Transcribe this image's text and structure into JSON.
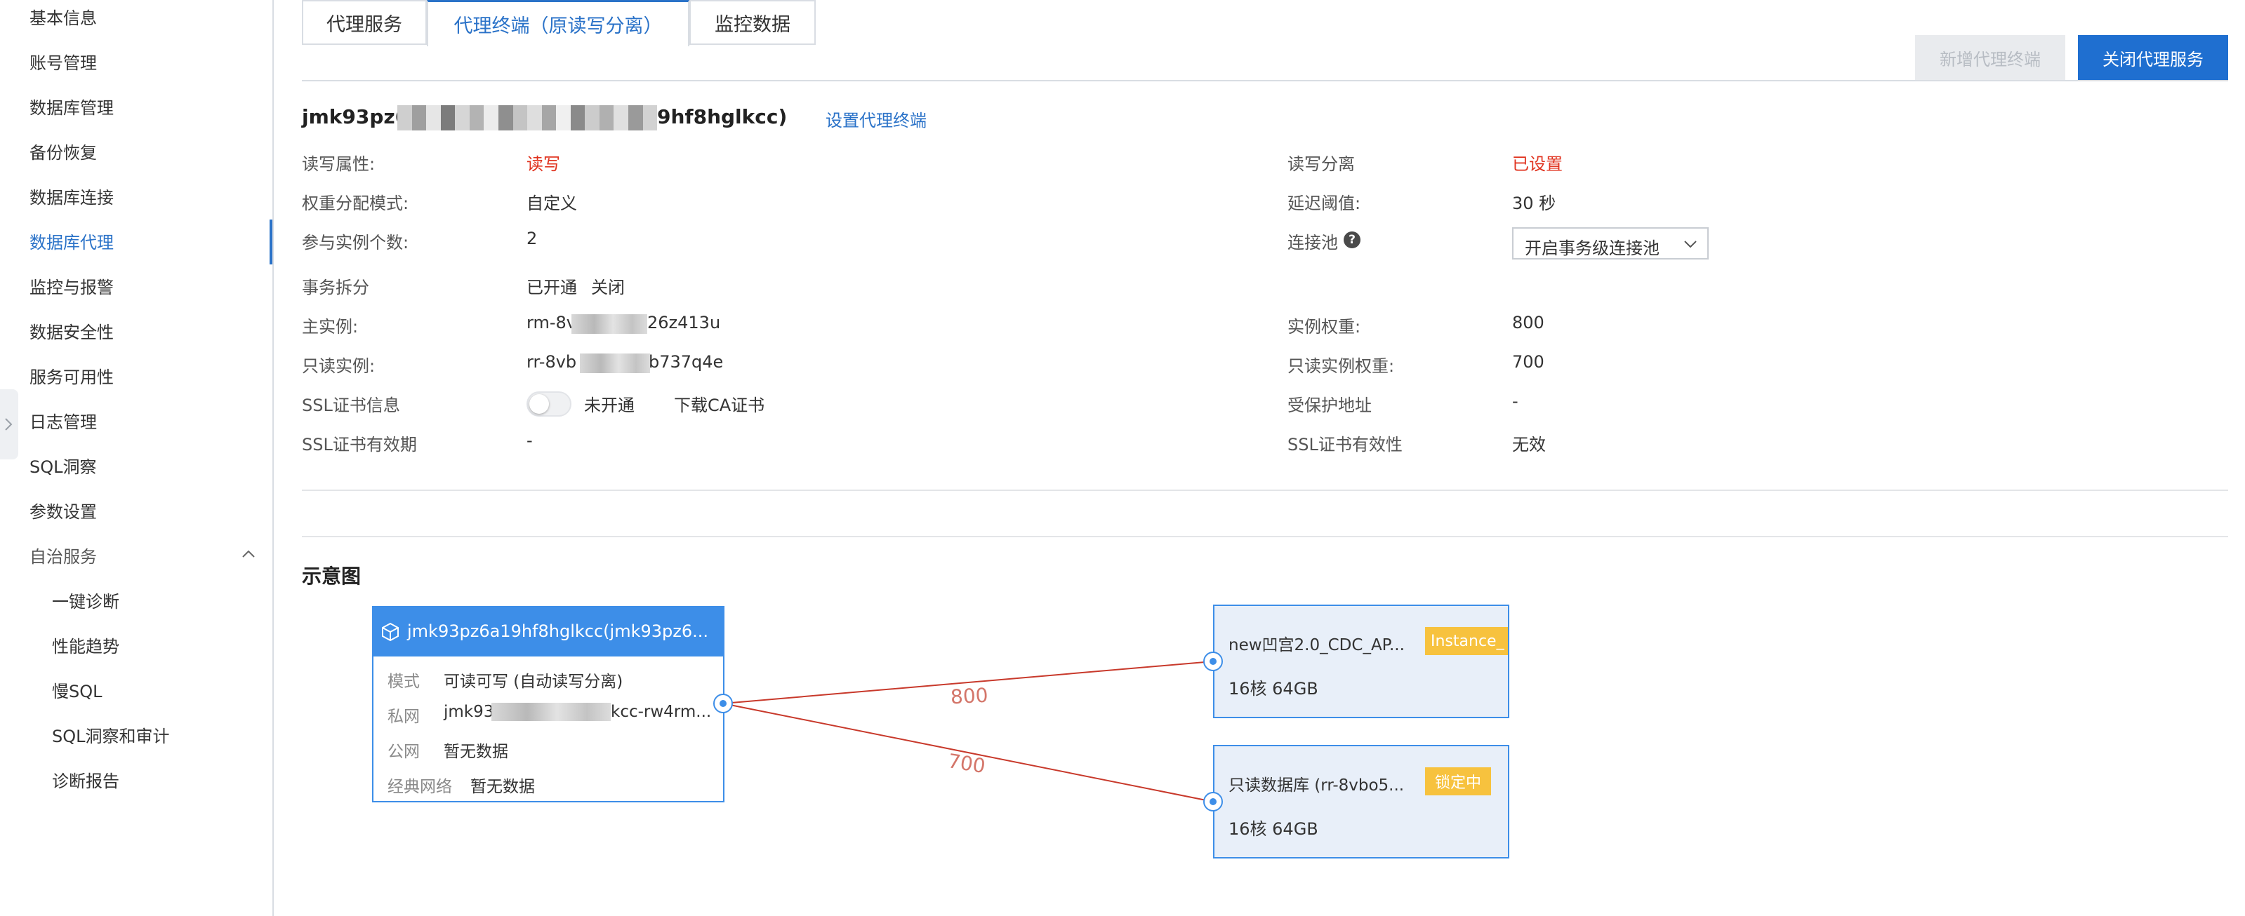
{
  "sidebar": {
    "items": [
      {
        "label": "基本信息"
      },
      {
        "label": "账号管理"
      },
      {
        "label": "数据库管理"
      },
      {
        "label": "备份恢复"
      },
      {
        "label": "数据库连接"
      },
      {
        "label": "数据库代理"
      },
      {
        "label": "监控与报警"
      },
      {
        "label": "数据安全性"
      },
      {
        "label": "服务可用性"
      },
      {
        "label": "日志管理"
      },
      {
        "label": "SQL洞察"
      },
      {
        "label": "参数设置"
      },
      {
        "label": "自治服务"
      }
    ],
    "sub_items": [
      {
        "label": "一键诊断"
      },
      {
        "label": "性能趋势"
      },
      {
        "label": "慢SQL"
      },
      {
        "label": "SQL洞察和审计"
      },
      {
        "label": "诊断报告"
      }
    ],
    "active_item": "数据库代理"
  },
  "tabs": [
    {
      "label": "代理服务"
    },
    {
      "label": "代理终端（原读写分离）",
      "active": true
    },
    {
      "label": "监控数据"
    }
  ],
  "buttons": {
    "add_endpoint": "新增代理终端",
    "close_service": "关闭代理服务"
  },
  "endpoint": {
    "title_prefix": "jmk93pz6a",
    "title_suffix": "9hf8hglkcc)",
    "set_link": "设置代理终端"
  },
  "details_left": [
    {
      "label": "读写属性:",
      "value": "读写"
    },
    {
      "label": "权重分配模式:",
      "value": "自定义"
    },
    {
      "label": "参与实例个数:",
      "value": "2"
    },
    {
      "label": "事务拆分",
      "value": "已开通",
      "link": "关闭"
    },
    {
      "label": "主实例:",
      "value_prefix": "rm-8v",
      "value_suffix": "26z413u"
    },
    {
      "label": "只读实例:",
      "value_prefix": "rr-8vb",
      "value_suffix": "b737q4e"
    },
    {
      "label": "SSL证书信息",
      "value": "未开通",
      "link": "下载CA证书"
    },
    {
      "label": "SSL证书有效期",
      "value": "-"
    }
  ],
  "details_right": [
    {
      "label": "读写分离",
      "value": "已设置"
    },
    {
      "label": "延迟阈值:",
      "value": "30 秒"
    },
    {
      "label": "连接池",
      "value": "开启事务级连接池"
    },
    {
      "label": "实例权重:",
      "value": "800"
    },
    {
      "label": "只读实例权重:",
      "value": "700"
    },
    {
      "label": "受保护地址",
      "value": "-"
    },
    {
      "label": "SSL证书有效性",
      "value": "无效"
    }
  ],
  "diagram": {
    "title": "示意图",
    "proxy": {
      "title": "jmk93pz6a19hf8hglkcc(jmk93pz6...",
      "rows": [
        {
          "key": "模式",
          "value": "可读可写 (自动读写分离)"
        },
        {
          "key": "私网",
          "value_prefix": "jmk93",
          "value_suffix": "kcc-rw4rm..."
        },
        {
          "key": "公网",
          "value": "暂无数据"
        },
        {
          "key": "经典网络",
          "value": "暂无数据"
        }
      ]
    },
    "primary_db": {
      "name": "new凹宫2.0_CDC_AP...",
      "tag": "Instance_",
      "spec": "16核 64GB",
      "weight": "800"
    },
    "readonly_db": {
      "name": "只读数据库 (rr-8vbo5...",
      "tag": "锁定中",
      "spec": "16核 64GB",
      "weight": "700"
    }
  },
  "colors": {
    "accent": "#2a72c8",
    "primary_button": "#1f6fd0",
    "red_text": "#e0321e",
    "diagram_border": "#3d8ee8",
    "db_fill": "#e8eff9",
    "tag": "#f7c23e",
    "link_line": "#c8392b"
  }
}
